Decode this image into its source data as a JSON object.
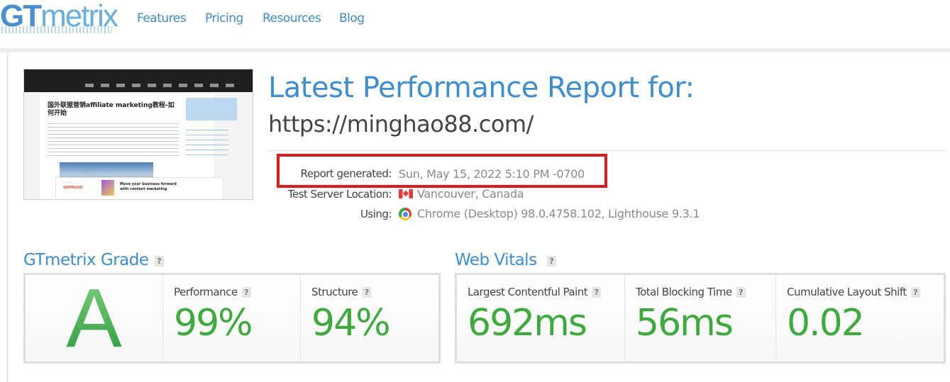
{
  "nav": {
    "logo_gt": "GT",
    "logo_metrix": "metrix",
    "items": [
      "Features",
      "Pricing",
      "Resources",
      "Blog"
    ]
  },
  "report": {
    "title": "Latest Performance Report for:",
    "url": "https://minghao88.com/",
    "generated_label": "Report generated:",
    "generated_value": "Sun, May 15, 2022 5:10 PM -0700",
    "location_label": "Test Server Location:",
    "location_value": "Vancouver, Canada",
    "using_label": "Using:",
    "using_value": "Chrome (Desktop) 98.0.4758.102, Lighthouse 9.3.1"
  },
  "thumbnail": {
    "site_heading": "国外联盟营销affiliate marketing教程-如何开始",
    "ad_brand": "SEMRUSH",
    "ad_text": "Move your business forward with content marketing"
  },
  "grade": {
    "title": "GTmetrix Grade",
    "help": "?",
    "letter": "A",
    "performance_label": "Performance",
    "performance_value": "99%",
    "structure_label": "Structure",
    "structure_value": "94%"
  },
  "vitals": {
    "title": "Web Vitals",
    "help": "?",
    "lcp_label": "Largest Contentful Paint",
    "lcp_value": "692ms",
    "tbt_label": "Total Blocking Time",
    "tbt_value": "56ms",
    "cls_label": "Cumulative Layout Shift",
    "cls_value": "0.02"
  },
  "colors": {
    "brand_blue": "#3b8ed1",
    "grade_green": "#3cab3c",
    "highlight_red": "#e01b1b"
  }
}
